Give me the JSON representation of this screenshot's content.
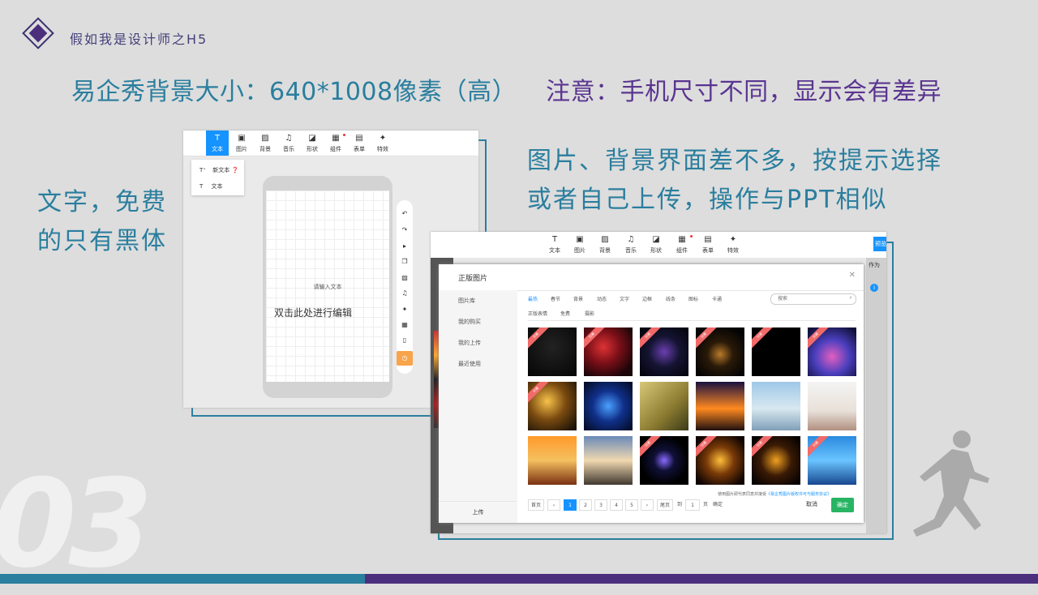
{
  "header": {
    "brand_title": "假如我是设计师之H5",
    "heading_blue": "易企秀背景大小：640*1008像素（高）",
    "heading_purple": "注意：手机尺寸不同，显示会有差异"
  },
  "notes": {
    "left_line1": "文字，免费",
    "left_line2": "的只有黑体",
    "right_line1": "图片、背景界面差不多，按提示选择",
    "right_line2": "或者自己上传，操作与PPT相似"
  },
  "slide_number": "03",
  "colors": {
    "blue": "#2a7e9e",
    "purple": "#4b2f7d",
    "accent": "#1593ff",
    "ok_green": "#27b463"
  },
  "editor": {
    "toolbar": [
      {
        "label": "文本",
        "icon": "text-icon"
      },
      {
        "label": "图片",
        "icon": "image-icon"
      },
      {
        "label": "背景",
        "icon": "background-icon"
      },
      {
        "label": "音乐",
        "icon": "music-icon"
      },
      {
        "label": "形状",
        "icon": "shape-icon"
      },
      {
        "label": "组件",
        "icon": "component-icon"
      },
      {
        "label": "表单",
        "icon": "form-icon"
      },
      {
        "label": "特效",
        "icon": "effect-icon"
      }
    ],
    "dropdown": {
      "new_text": "新文本",
      "text": "文本"
    },
    "phone": {
      "placeholder": "请输入文本",
      "edit_hint": "双击此处进行编辑"
    }
  },
  "image_dialog": {
    "preview_label": "预览",
    "title": "正版图片",
    "side_items": [
      "图片库",
      "我的购买",
      "我的上传",
      "最近使用"
    ],
    "upload_label": "上传",
    "categories": [
      "最热",
      "春节",
      "背景",
      "动态",
      "文字",
      "边框",
      "线条",
      "图标",
      "卡通"
    ],
    "sub_categories": [
      "正版表情",
      "免费",
      "摄影"
    ],
    "search_placeholder": "搜索",
    "ribbon_label": "付费",
    "pagination": {
      "prev": "首页",
      "pages": [
        "1",
        "2",
        "3",
        "4",
        "5"
      ],
      "last": "尾页",
      "goto_prefix": "到",
      "goto_value": "1",
      "goto_suffix": "页",
      "confirm": "确定"
    },
    "legal_text": "使用图片即代表同意并接受",
    "legal_link": "《易企秀图片版权许可与服务协议》",
    "cancel": "取消",
    "ok": "确定",
    "right_panel_label": "作为"
  }
}
